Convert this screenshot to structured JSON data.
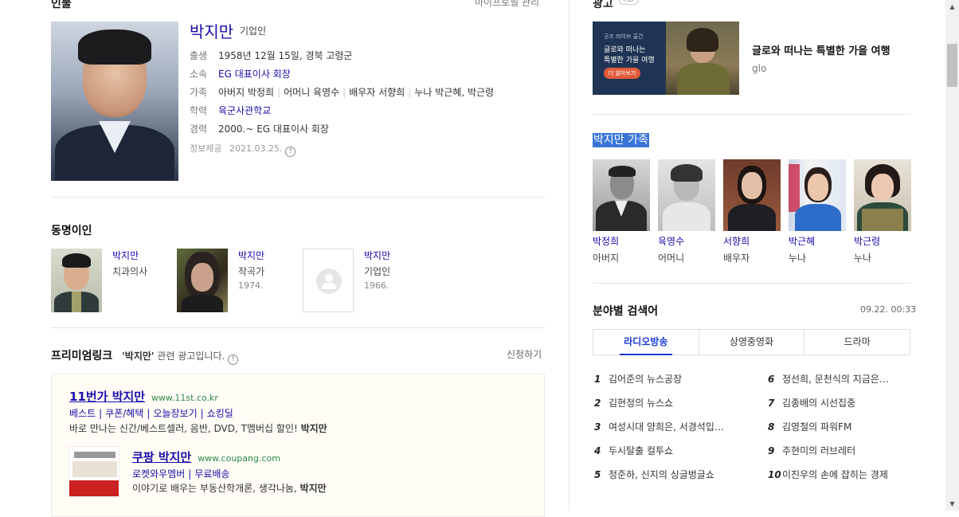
{
  "profile": {
    "section_title": "인물",
    "manage_link": "마이프로필 관리",
    "name": "박지만",
    "job": "기업인",
    "rows": {
      "birth": {
        "key": "출생",
        "value": "1958년 12월 15일, 경북 고령군"
      },
      "affiliation": {
        "key": "소속",
        "value": "EG 대표이사 회장"
      },
      "family": {
        "key": "가족",
        "items": [
          "아버지 박정희",
          "어머니 육영수",
          "배우자 서향희",
          "누나 박근혜, 박근령"
        ]
      },
      "education": {
        "key": "학력",
        "value": "육군사관학교"
      },
      "career": {
        "key": "경력",
        "value": "2000.~ EG 대표이사 회장"
      }
    },
    "source": "정보제공",
    "source_date": "2021.03.25."
  },
  "namesakes": {
    "title": "동명이인",
    "items": [
      {
        "name": "박지만",
        "job": "치과의사",
        "year": ""
      },
      {
        "name": "박지만",
        "job": "작곡가",
        "year": "1974."
      },
      {
        "name": "박지만",
        "job": "기업인",
        "year": "1966."
      }
    ]
  },
  "premium": {
    "title": "프리미엄링크",
    "query": "'박지만'",
    "desc": "관련 광고입니다.",
    "apply": "신청하기",
    "ads": [
      {
        "title": "11번가 박지만",
        "url": "www.11st.co.kr",
        "links": [
          "베스트",
          "쿠폰/혜택",
          "오늘장보기",
          "쇼킹딜"
        ],
        "desc": "바로 만나는 신간/베스트셀러, 음반, DVD, T멤버십 할인!",
        "bold": "박지만"
      },
      {
        "title": "쿠팡 박지만",
        "url": "www.coupang.com",
        "links": [
          "로켓와우멤버",
          "무료배송"
        ],
        "desc": "이야기로 배우는 부동산학개론, 생각나눔,",
        "bold": "박지만"
      }
    ]
  },
  "right_ad": {
    "label": "광고",
    "badge": "AD",
    "banner_lines": [
      "굿즈 라이브 출간",
      "글로와 떠나는",
      "특별한 가을 여행",
      "더 알아보기"
    ],
    "title": "글로와 떠나는 특별한 가을 여행",
    "sub": "glo"
  },
  "family": {
    "title": "박지만 가족",
    "members": [
      {
        "name": "박정희",
        "role": "아버지"
      },
      {
        "name": "육영수",
        "role": "어머니"
      },
      {
        "name": "서향희",
        "role": "배우자"
      },
      {
        "name": "박근혜",
        "role": "누나"
      },
      {
        "name": "박근령",
        "role": "누나"
      }
    ]
  },
  "keywords": {
    "title": "분야별 검색어",
    "time": "09.22. 00:33",
    "tabs": [
      "라디오방송",
      "상영중영화",
      "드라마"
    ],
    "active_tab": "라디오방송",
    "items": [
      {
        "n": "1",
        "text": "김어준의 뉴스공장"
      },
      {
        "n": "2",
        "text": "김현정의 뉴스쇼"
      },
      {
        "n": "3",
        "text": "여성시대 양희은, 서경석입…"
      },
      {
        "n": "4",
        "text": "두시탈출 컬투쇼"
      },
      {
        "n": "5",
        "text": "정준하, 신지의 싱글벙글쇼"
      },
      {
        "n": "6",
        "text": "정선희, 문천식의 지금은…"
      },
      {
        "n": "7",
        "text": "김종배의 시선집중"
      },
      {
        "n": "8",
        "text": "김영철의 파워FM"
      },
      {
        "n": "9",
        "text": "주현미의 러브레터"
      },
      {
        "n": "10",
        "text": "이진우의 손에 잡히는 경제"
      }
    ]
  },
  "colors": {
    "link": "#1a0dab",
    "selection": "#3875d7",
    "tab_active": "#1a3bd1"
  }
}
